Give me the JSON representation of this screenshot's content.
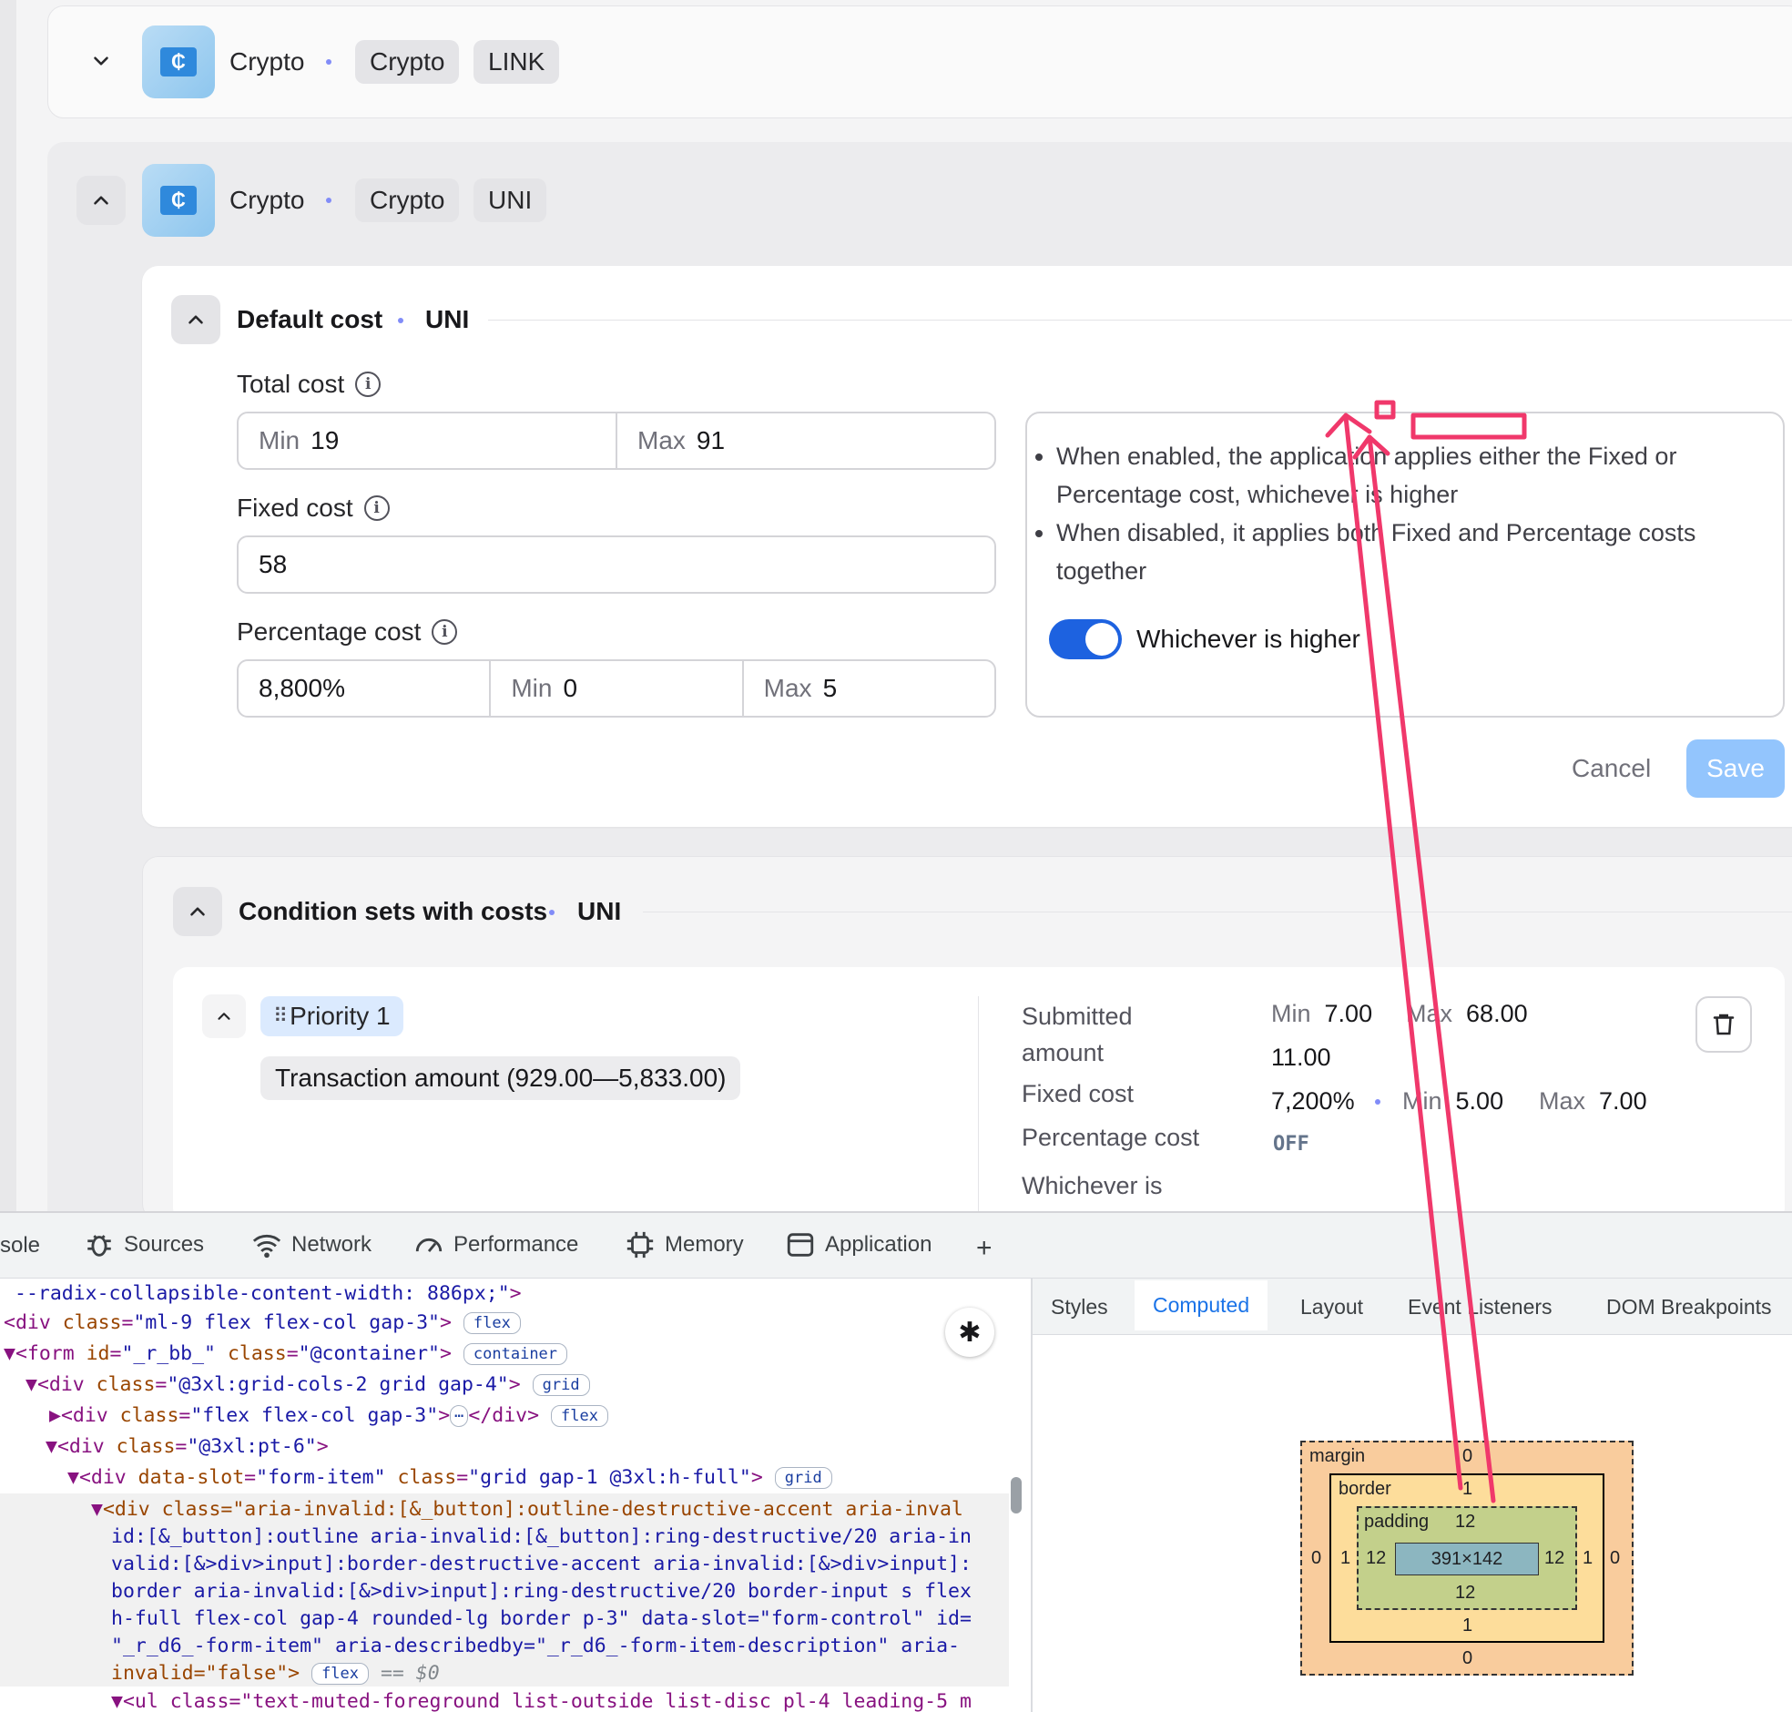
{
  "colors": {
    "accent": "#1d62e0",
    "save_disabled": "#93c5fd",
    "annotation": "#f0386b"
  },
  "asset_rows": [
    {
      "name": "Crypto",
      "category": "Crypto",
      "symbol": "LINK",
      "expanded": false
    },
    {
      "name": "Crypto",
      "category": "Crypto",
      "symbol": "UNI",
      "expanded": true
    }
  ],
  "default_cost": {
    "title": "Default cost",
    "symbol": "UNI",
    "total_cost": {
      "label": "Total cost",
      "min_label": "Min",
      "min_value": "19",
      "max_label": "Max",
      "max_value": "91"
    },
    "fixed_cost": {
      "label": "Fixed cost",
      "value": "58"
    },
    "percentage_cost": {
      "label": "Percentage cost",
      "value": "8,800%",
      "min_label": "Min",
      "min_value": "0",
      "max_label": "Max",
      "max_value": "5"
    },
    "notes": [
      "When enabled, the application applies either the Fixed or Percentage cost, whichever is higher",
      "When disabled, it applies both Fixed and Percentage costs together"
    ],
    "toggle": {
      "label": "Whichever is higher",
      "on": true
    },
    "cancel_label": "Cancel",
    "save_label": "Save"
  },
  "conditions": {
    "title": "Condition sets with costs",
    "symbol": "UNI",
    "priority_label": "Priority 1",
    "condition_text": "Transaction amount (929.00—5,833.00)",
    "submitted_amount_label": "Submitted amount",
    "submitted_min_label": "Min",
    "submitted_min": "7.00",
    "submitted_max_label": "Max",
    "submitted_max": "68.00",
    "fixed_cost_label": "Fixed cost",
    "fixed_cost_value": "11.00",
    "percentage_cost_label": "Percentage cost",
    "percentage_value": "7,200%",
    "percentage_min_label": "Min",
    "percentage_min": "5.00",
    "percentage_max_label": "Max",
    "percentage_max": "7.00",
    "whichever_label": "Whichever is higher",
    "whichever_value": "OFF"
  },
  "devtools": {
    "tabs": [
      "sole",
      "Sources",
      "Network",
      "Performance",
      "Memory",
      "Application"
    ],
    "code_lines": [
      {
        "indent": 0,
        "arrow": "",
        "html": "--radix-collapsible-content-width: 886px;\">",
        "badge": ""
      },
      {
        "indent": 0,
        "arrow": "",
        "tag": "div",
        "attrs": "class=\"ml-9 flex flex-col gap-3\"",
        "badge": "flex"
      },
      {
        "indent": 0,
        "arrow": "▼",
        "tag": "form",
        "attrs": "id=\"_r_bb_\" class=\"@container\"",
        "badge": "container"
      },
      {
        "indent": 1,
        "arrow": "▼",
        "tag": "div",
        "attrs": "class=\"@3xl:grid-cols-2 grid gap-4\"",
        "badge": "grid"
      },
      {
        "indent": 2,
        "arrow": "▶",
        "tag": "div",
        "attrs": "class=\"flex flex-col gap-3\"",
        "badge": "flex",
        "collapsed": true
      },
      {
        "indent": 2,
        "arrow": "▼",
        "tag": "div",
        "attrs": "class=\"@3xl:pt-6\"",
        "badge": ""
      },
      {
        "indent": 3,
        "arrow": "▼",
        "tag": "div",
        "attrs": "data-slot=\"form-item\" class=\"grid gap-1 @3xl:h-full\"",
        "badge": "grid"
      }
    ],
    "selected_node_text": [
      "<div class=\"aria-invalid:[&_button]:outline-destructive-accent aria-inval",
      "id:[&_button]:outline aria-invalid:[&_button]:ring-destructive/20 aria-in",
      "valid:[&>div>input]:border-destructive-accent aria-invalid:[&>div>input]:",
      "border aria-invalid:[&>div>input]:ring-destructive/20 border-input s flex",
      "h-full flex-col gap-4 rounded-lg border p-3\" data-slot=\"form-control\" id=",
      "\"_r_d6_-form-item\" aria-describedby=\"_r_d6_-form-item-description\" aria-",
      "invalid=\"false\">"
    ],
    "selected_badge": "flex",
    "selected_suffix": "== $0",
    "last_line": "<ul class=\"text-muted-foreground list-outside list-disc pl-4 leading-5 m",
    "sidebar_tabs": [
      "Styles",
      "Computed",
      "Layout",
      "Event Listeners",
      "DOM Breakpoints"
    ],
    "sidebar_active": "Computed",
    "box_model": {
      "margin_label": "margin",
      "margin": [
        "0",
        "0",
        "0",
        "0"
      ],
      "border_label": "border",
      "border": [
        "1",
        "1",
        "1",
        "1"
      ],
      "padding_label": "padding",
      "padding": [
        "12",
        "12",
        "12",
        "12"
      ],
      "content": "391×142"
    }
  }
}
